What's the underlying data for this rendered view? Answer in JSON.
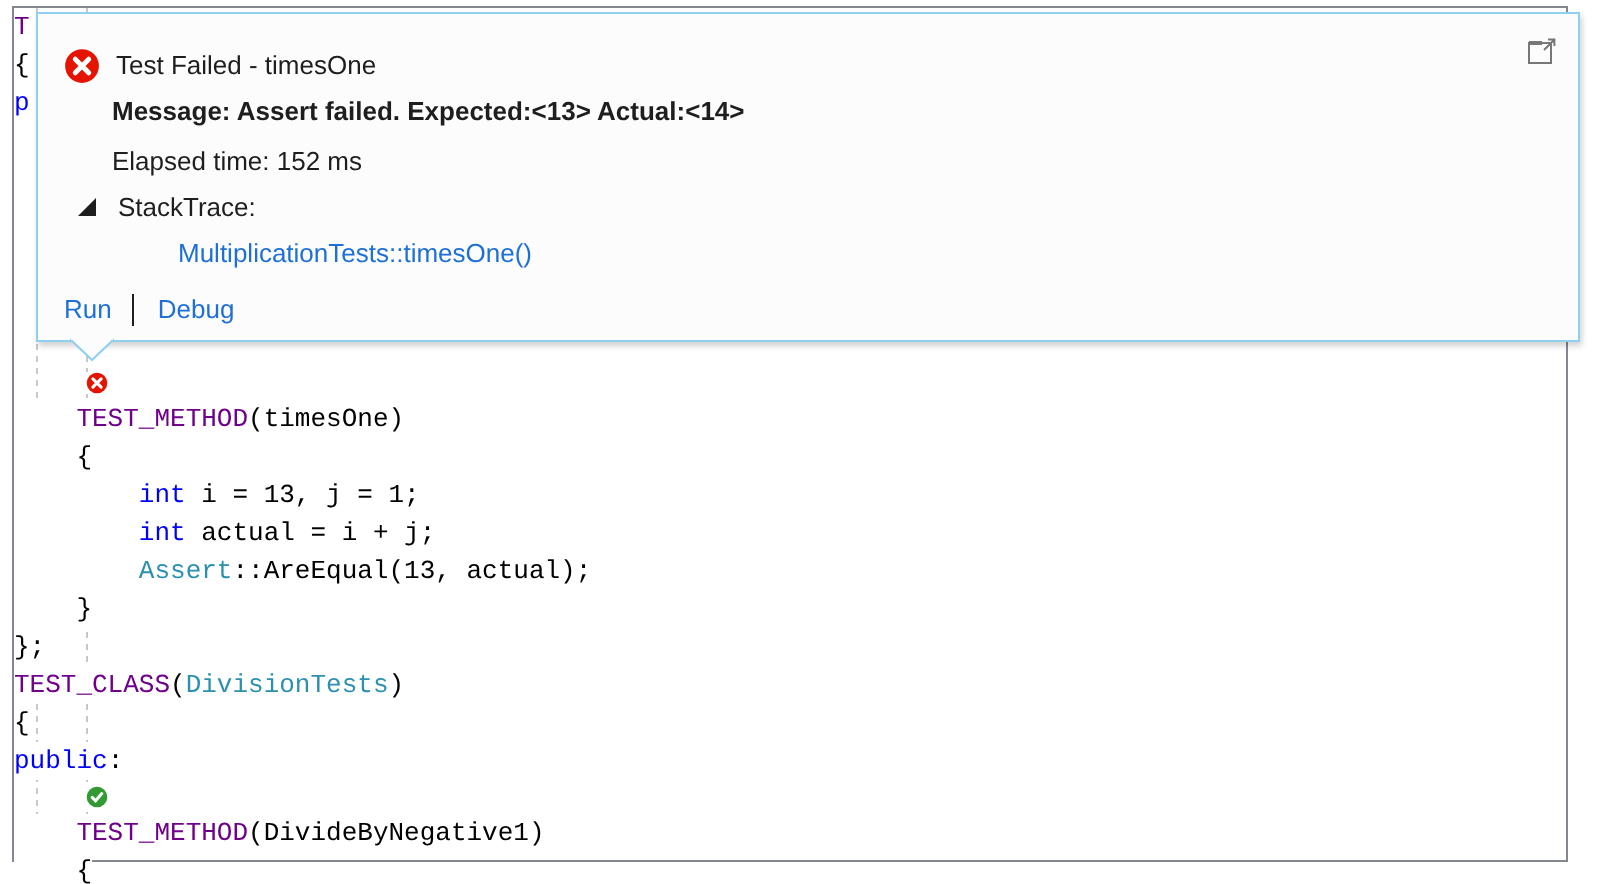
{
  "editor": {
    "top_lines": [
      [
        {
          "text": "T",
          "kind": "macro"
        }
      ],
      [
        {
          "text": "{",
          "kind": "plain"
        }
      ],
      [
        {
          "text": "p",
          "kind": "keyword"
        }
      ]
    ],
    "lines": [
      {
        "kind": "status",
        "passed": false
      },
      {
        "kind": "code",
        "tokens": [
          {
            "text": "    TEST_METHOD",
            "kind": "macro"
          },
          {
            "text": "(timesOne)",
            "kind": "plain"
          }
        ]
      },
      {
        "kind": "code",
        "tokens": [
          {
            "text": "    {",
            "kind": "plain"
          }
        ]
      },
      {
        "kind": "code",
        "tokens": [
          {
            "text": "        int",
            "kind": "keyword"
          },
          {
            "text": " i = 13, j = 1;",
            "kind": "plain"
          }
        ]
      },
      {
        "kind": "code",
        "tokens": [
          {
            "text": "        int",
            "kind": "keyword"
          },
          {
            "text": " actual = i + j;",
            "kind": "plain"
          }
        ]
      },
      {
        "kind": "code",
        "tokens": [
          {
            "text": "        Assert",
            "kind": "type"
          },
          {
            "text": "::AreEqual(13, actual);",
            "kind": "plain"
          }
        ]
      },
      {
        "kind": "code",
        "tokens": [
          {
            "text": "    }",
            "kind": "plain"
          }
        ]
      },
      {
        "kind": "code",
        "tokens": [
          {
            "text": "};",
            "kind": "plain"
          }
        ]
      },
      {
        "kind": "code",
        "tokens": [
          {
            "text": "TEST_CLASS",
            "kind": "macro"
          },
          {
            "text": "(",
            "kind": "plain"
          },
          {
            "text": "DivisionTests",
            "kind": "type"
          },
          {
            "text": ")",
            "kind": "plain"
          }
        ]
      },
      {
        "kind": "code",
        "tokens": [
          {
            "text": "{",
            "kind": "plain"
          }
        ]
      },
      {
        "kind": "code",
        "tokens": [
          {
            "text": "public",
            "kind": "keyword"
          },
          {
            "text": ":",
            "kind": "plain"
          }
        ]
      },
      {
        "kind": "status",
        "passed": true
      },
      {
        "kind": "code",
        "tokens": [
          {
            "text": "    TEST_METHOD",
            "kind": "macro"
          },
          {
            "text": "(DivideByNegative1)",
            "kind": "plain"
          }
        ]
      },
      {
        "kind": "code",
        "tokens": [
          {
            "text": "    {",
            "kind": "plain"
          }
        ]
      }
    ]
  },
  "popup": {
    "passed": false,
    "title": "Test Failed - timesOne",
    "message": "Message: Assert failed. Expected:<13> Actual:<14>",
    "elapsed": "Elapsed time: 152 ms",
    "stacktrace": {
      "label": "StackTrace:",
      "expanded": true,
      "frames": [
        "MultiplicationTests::timesOne()"
      ]
    },
    "actions": [
      "Run",
      "Debug"
    ]
  }
}
